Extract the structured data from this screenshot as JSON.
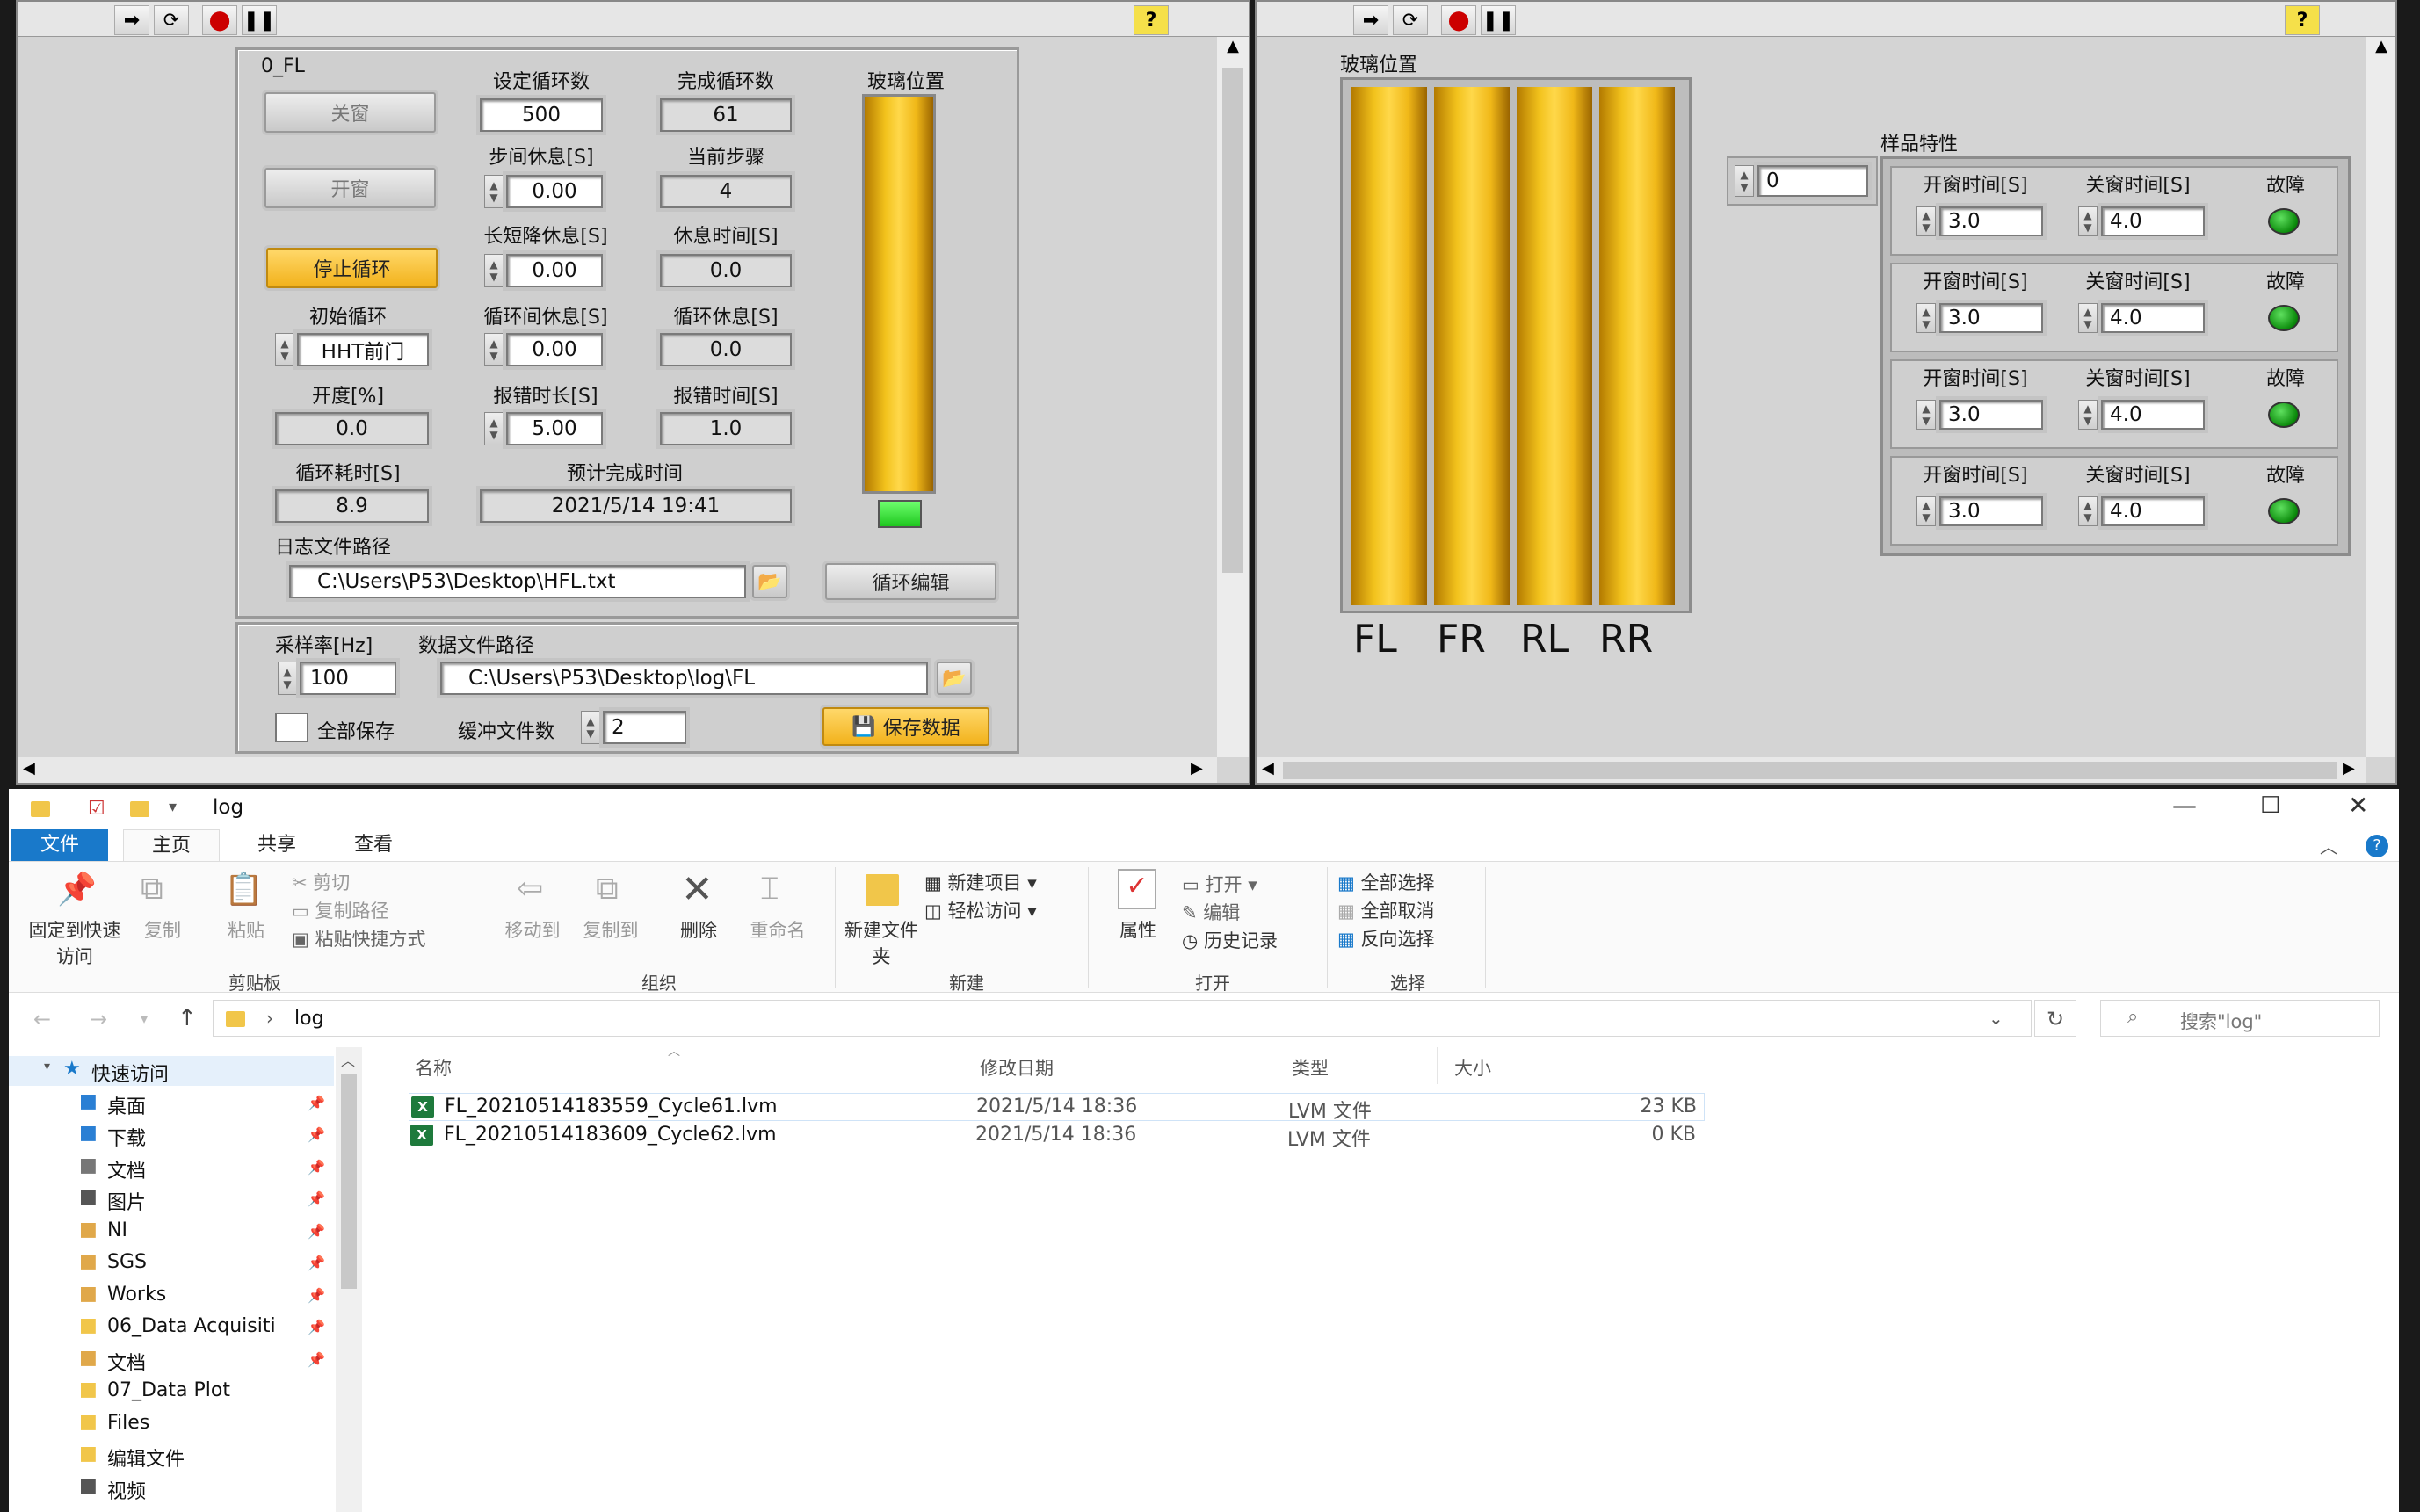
{
  "left_vi": {
    "panel_title": "0_FL",
    "close_button": "关窗",
    "open_button": "开窗",
    "stop_button": "停止循环",
    "fields": {
      "set_cycles": {
        "label": "设定循环数",
        "value": "500"
      },
      "done_cycles": {
        "label": "完成循环数",
        "value": "61"
      },
      "step_rest": {
        "label": "步间休息[S]",
        "value": "0.00"
      },
      "current_step": {
        "label": "当前步骤",
        "value": "4"
      },
      "long_short_rest": {
        "label": "长短降休息[S]",
        "value": "0.00"
      },
      "rest_time": {
        "label": "休息时间[S]",
        "value": "0.0"
      },
      "init_cycle": {
        "label": "初始循环",
        "value": "HHT前门"
      },
      "cycle_gap_rest": {
        "label": "循环间休息[S]",
        "value": "0.00"
      },
      "cycle_rest": {
        "label": "循环休息[S]",
        "value": "0.0"
      },
      "opening": {
        "label": "开度[%]",
        "value": "0.0"
      },
      "err_duration": {
        "label": "报错时长[S]",
        "value": "5.00"
      },
      "err_time": {
        "label": "报错时间[S]",
        "value": "1.0"
      },
      "cycle_elapsed": {
        "label": "循环耗时[S]",
        "value": "8.9"
      },
      "eta": {
        "label": "预计完成时间",
        "value": "2021/5/14 19:41"
      }
    },
    "glass_label": "玻璃位置",
    "log_path_label": "日志文件路径",
    "log_path": "C:\\Users\\P53\\Desktop\\HFL.txt",
    "cycle_edit_button": "循环编辑",
    "sample_rate_label": "采样率[Hz]",
    "sample_rate": "100",
    "data_path_label": "数据文件路径",
    "data_path": "C:\\Users\\P53\\Desktop\\log\\FL",
    "save_all_label": "全部保存",
    "buffer_label": "缓冲文件数",
    "buffer_value": "2",
    "save_button": "保存数据"
  },
  "right_vi": {
    "glass_label": "玻璃位置",
    "channels": [
      "FL",
      "FR",
      "RL",
      "RR"
    ],
    "index_value": "0",
    "sample_label": "样品特性",
    "rows": [
      {
        "open_label": "开窗时间[S]",
        "open": "3.0",
        "close_label": "关窗时间[S]",
        "close": "4.0",
        "fault_label": "故障"
      },
      {
        "open_label": "开窗时间[S]",
        "open": "3.0",
        "close_label": "关窗时间[S]",
        "close": "4.0",
        "fault_label": "故障"
      },
      {
        "open_label": "开窗时间[S]",
        "open": "3.0",
        "close_label": "关窗时间[S]",
        "close": "4.0",
        "fault_label": "故障"
      },
      {
        "open_label": "开窗时间[S]",
        "open": "3.0",
        "close_label": "关窗时间[S]",
        "close": "4.0",
        "fault_label": "故障"
      }
    ]
  },
  "explorer": {
    "title": "log",
    "tabs": [
      "文件",
      "主页",
      "共享",
      "查看"
    ],
    "clipboard": {
      "pin": "固定到快速访问",
      "copy": "复制",
      "paste": "粘贴",
      "cut": "剪切",
      "copy_path": "复制路径",
      "paste_shortcut": "粘贴快捷方式",
      "group": "剪贴板"
    },
    "organize": {
      "move": "移动到",
      "copyto": "复制到",
      "delete": "删除",
      "rename": "重命名",
      "group": "组织"
    },
    "new": {
      "new_folder": "新建文件夹",
      "new_item": "新建项目",
      "easy_access": "轻松访问",
      "group": "新建"
    },
    "open": {
      "properties": "属性",
      "open": "打开",
      "edit": "编辑",
      "history": "历史记录",
      "group": "打开"
    },
    "select": {
      "all": "全部选择",
      "none": "全部取消",
      "invert": "反向选择",
      "group": "选择"
    },
    "address": "log",
    "search_placeholder": "搜索\"log\"",
    "nav": [
      {
        "label": "快速访问",
        "pinned": false
      },
      {
        "label": "桌面",
        "pinned": true
      },
      {
        "label": "下载",
        "pinned": true
      },
      {
        "label": "文档",
        "pinned": true
      },
      {
        "label": "图片",
        "pinned": true
      },
      {
        "label": "NI",
        "pinned": true
      },
      {
        "label": "SGS",
        "pinned": true
      },
      {
        "label": "Works",
        "pinned": true
      },
      {
        "label": "06_Data Acquisiti",
        "pinned": true
      },
      {
        "label": "文档",
        "pinned": true
      },
      {
        "label": "07_Data Plot",
        "pinned": false
      },
      {
        "label": "Files",
        "pinned": false
      },
      {
        "label": "编辑文件",
        "pinned": false
      },
      {
        "label": "视频",
        "pinned": false
      }
    ],
    "columns": {
      "name": "名称",
      "date": "修改日期",
      "type": "类型",
      "size": "大小"
    },
    "files": [
      {
        "name": "FL_20210514183559_Cycle61.lvm",
        "date": "2021/5/14 18:36",
        "type": "LVM 文件",
        "size": "23 KB"
      },
      {
        "name": "FL_20210514183609_Cycle62.lvm",
        "date": "2021/5/14 18:36",
        "type": "LVM 文件",
        "size": "0 KB"
      }
    ]
  },
  "colors": {
    "accent": "#1979ca",
    "gold": "#f2c21c",
    "led_green": "#1aa61a"
  }
}
